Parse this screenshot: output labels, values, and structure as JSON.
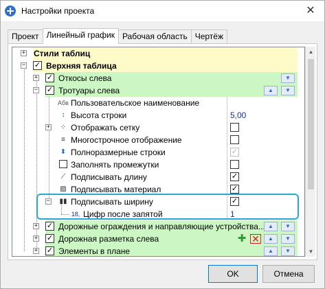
{
  "window": {
    "title": "Настройки проекта",
    "close": "✕"
  },
  "tabs": [
    "Проект",
    "Линейный график",
    "Рабочая область",
    "Чертёж"
  ],
  "active_tab": "Линейный график",
  "tree": {
    "rows": [
      {
        "label": "Стили таблиц",
        "bold": true
      },
      {
        "label": "Верхняя таблица",
        "bold": true
      },
      {
        "label": "Откосы слева"
      },
      {
        "label": "Тротуары слева"
      },
      {
        "label": "Пользовательское наименование",
        "icon": "Абв"
      },
      {
        "label": "Высота строки",
        "value": "5,00"
      },
      {
        "label": "Отображать сетку"
      },
      {
        "label": "Многострочное отображение"
      },
      {
        "label": "Полноразмерные строки"
      },
      {
        "label": "Заполнять промежутки"
      },
      {
        "label": "Подписывать длину"
      },
      {
        "label": "Подписывать материал"
      },
      {
        "label": "Подписывать ширину"
      },
      {
        "label": "Цифр после запятой",
        "value": "1",
        "icon": "18,"
      },
      {
        "label": "Дорожные ограждения и направляющие устройства..."
      },
      {
        "label": "Дорожная разметка слева"
      },
      {
        "label": "Элементы в плане"
      }
    ]
  },
  "icons": {
    "up": "▲",
    "down": "▼",
    "plus": "✚",
    "remove": "✕",
    "check": "✓",
    "expand": "+",
    "collapse": "−",
    "scroll_up": "▲",
    "scroll_down": "▼"
  },
  "colors": {
    "yellow_row": "#fffbc8",
    "green_row": "#ccf7c4",
    "highlight": "#29a8d8",
    "value_text": "#1a2fa0"
  },
  "buttons": {
    "ok": "OK",
    "cancel": "Отмена"
  }
}
